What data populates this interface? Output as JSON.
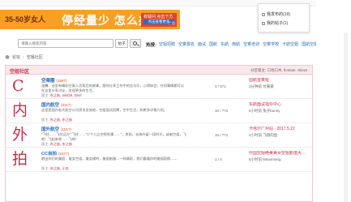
{
  "top": {
    "link": "论坛"
  },
  "ad": {
    "left_text": "35-50岁女人",
    "main_text": "停经量少 怎么办",
    "side_line": "有疑问 点击下方咨询",
    "cta": "点击查看更多",
    "tag": "广告"
  },
  "user_menu": {
    "items": [
      {
        "label": "我发布的(19)",
        "icon": "reply-icon"
      },
      {
        "label": "我的帖子(1)",
        "icon": "post-icon"
      }
    ]
  },
  "search": {
    "placeholder": "请输入搜索内容",
    "scope": "帖子",
    "button_icon": "search-icon",
    "hot_label": "热搜:",
    "hot_tags": [
      "空姐招聘",
      "空乘报名",
      "面试",
      "国航",
      "东航",
      "南航",
      "空乘培训",
      "空乘学校",
      "卡航空姐",
      "国航空姐"
    ]
  },
  "breadcrumb": {
    "home_icon": "home-icon",
    "items": [
      "论坛",
      "空姐社区"
    ]
  },
  "forum": {
    "title": "空姐社区",
    "moderators": "分区版主: 口地口木, flonkae, Stiiwa",
    "boards": [
      {
        "icon_char": "C",
        "name": "空乘圈",
        "new_count": "(1597)",
        "desc": "温馨、这里有精彩空乘人员背后的故事，跟你分享工作中的苦与乐，心得体会；任何事情都可以在这里分享讨论，发现更多的生活...",
        "mods_label": "版主:",
        "mods": "东之航, mk829, Zwef",
        "counts": "3 / 571",
        "last_title": "国航首乘班",
        "last_by": "3分钟前 付嘉豪"
      },
      {
        "icon_char": "内",
        "name": "国内航空",
        "new_count": "(3117)",
        "desc": "这里是国内各大航空公司资讯交流地，空姐面试招聘，空中生活，和更多详情介绍。",
        "mods_label": "版主:",
        "mods": "东之航, 东之航",
        "counts": "10 / 771",
        "last_title": "东航面试指导中心",
        "last_by": "6小时前 兔子bunny"
      },
      {
        "icon_char": "外",
        "name": "国外航空",
        "new_count": "(1517)",
        "desc": "\"飞往……飞往远方\" 飞往……\"少个儿立空那些事……\"，发帖，去海外留一段时光，或者空姐，飞吧！飞起来吧……飞吧！",
        "mods_label": "版主:",
        "mods": "东之航, 东之航",
        "counts": "16 / 771",
        "last_title": "卡塔尔广州站 - 2017.5.22",
        "last_by": "4小时前 飞翔的鱼"
      },
      {
        "icon_char": "拍",
        "name": "CC自拍",
        "new_count": "(1577)",
        "desc": "晒出你们的美丽，美女空姐，美女模特，美丽制服…一样精彩，我们看看你的美丽容颜……",
        "mods_label": "版主:",
        "mods": "东之航, 小丸",
        "counts": "1 / 4",
        "last_title": "中国空姐绝美美女空姐颜值大...",
        "last_by": "6小时前 fetianmeng"
      }
    ]
  }
}
